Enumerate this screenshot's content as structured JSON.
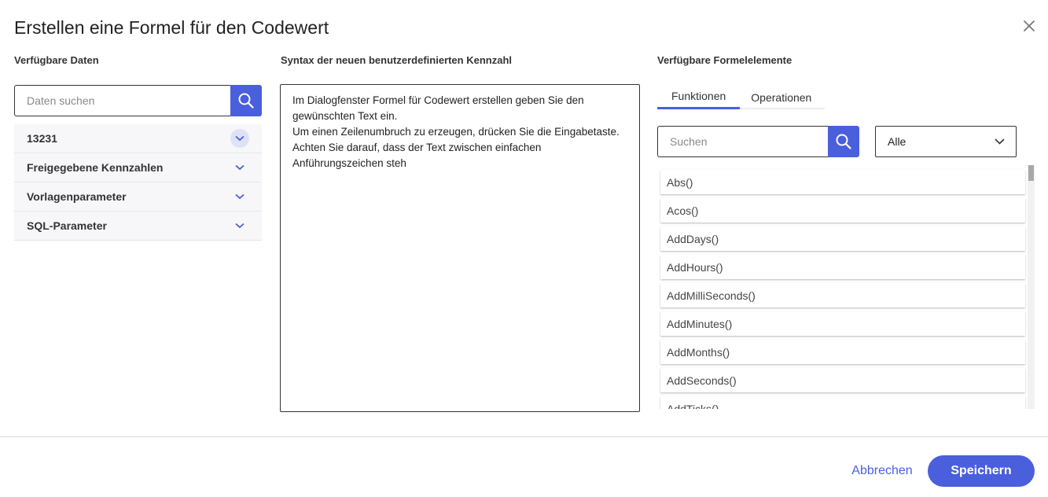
{
  "dialog": {
    "title": "Erstellen eine Formel für den Codewert"
  },
  "left": {
    "label": "Verfügbare Daten",
    "search_placeholder": "Daten suchen",
    "tree_items": [
      {
        "label": "13231",
        "expanded": true
      },
      {
        "label": "Freigegebene Kennzahlen",
        "expanded": false
      },
      {
        "label": "Vorlagenparameter",
        "expanded": false
      },
      {
        "label": "SQL-Parameter",
        "expanded": false
      }
    ]
  },
  "middle": {
    "label": "Syntax der neuen benutzerdefinierten Kennzahl",
    "lines": [
      "Im Dialogfenster Formel für Codewert erstellen geben Sie den gewünschten Text ein.",
      "Um einen Zeilenumbruch zu erzeugen, drücken Sie die Eingabetaste.",
      "Achten Sie darauf, dass der Text zwischen einfachen Anführungszeichen steh"
    ]
  },
  "right": {
    "label": "Verfügbare Formelelemente",
    "tabs": [
      "Funktionen",
      "Operationen"
    ],
    "active_tab": 0,
    "search_placeholder": "Suchen",
    "select_value": "Alle",
    "functions": [
      "Abs()",
      "Acos()",
      "AddDays()",
      "AddHours()",
      "AddMilliSeconds()",
      "AddMinutes()",
      "AddMonths()",
      "AddSeconds()",
      "AddTicks()"
    ]
  },
  "footer": {
    "cancel_label": "Abbrechen",
    "save_label": "Speichern"
  },
  "colors": {
    "accent": "#4a5fdc"
  }
}
